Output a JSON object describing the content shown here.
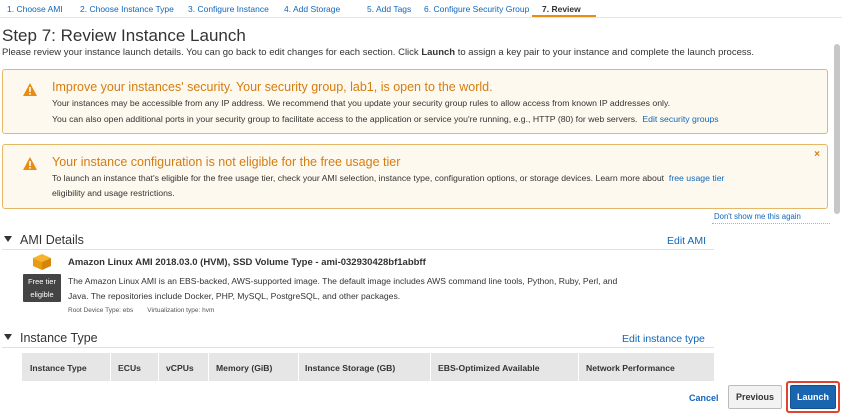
{
  "tabs": [
    {
      "label": "1. Choose AMI"
    },
    {
      "label": "2. Choose Instance Type"
    },
    {
      "label": "3. Configure Instance"
    },
    {
      "label": "4. Add Storage"
    },
    {
      "label": "5. Add Tags"
    },
    {
      "label": "6. Configure Security Group"
    },
    {
      "label": "7. Review",
      "active": true
    }
  ],
  "page": {
    "title": "Step 7: Review Instance Launch",
    "desc_before": "Please review your instance launch details. You can go back to edit changes for each section. Click ",
    "desc_bold": "Launch",
    "desc_after": " to assign a key pair to your instance and complete the launch process."
  },
  "security_warning": {
    "title": "Improve your instances' security. Your security group, lab1, is open to the world.",
    "line1": "Your instances may be accessible from any IP address. We recommend that you update your security group rules to allow access from known IP addresses only.",
    "line2": "You can also open additional ports in your security group to facilitate access to the application or service you're running, e.g., HTTP (80) for web servers.",
    "link": "Edit security groups"
  },
  "free_tier_warning": {
    "title": "Your instance configuration is not eligible for the free usage tier",
    "line1": "To launch an instance that's eligible for the free usage tier, check your AMI selection, instance type, configuration options, or storage devices. Learn more about",
    "link": "free usage tier",
    "line2": "eligibility and usage restrictions.",
    "close": "×"
  },
  "dont_show": "Don't show me this again",
  "ami_section": {
    "heading": "AMI Details",
    "edit_link": "Edit AMI",
    "badge_line1": "Free tier",
    "badge_line2": "eligible",
    "title": "Amazon Linux AMI 2018.03.0 (HVM), SSD Volume Type - ami-032930428bf1abbff",
    "desc": "The Amazon Linux AMI is an EBS-backed, AWS-supported image. The default image includes AWS command line tools, Python, Ruby, Perl, and Java. The repositories include Docker, PHP, MySQL, PostgreSQL, and other packages.",
    "root_device": "Root Device Type: ebs",
    "virtualization": "Virtualization type: hvm"
  },
  "instance_section": {
    "heading": "Instance Type",
    "edit_link": "Edit instance type",
    "columns": [
      "Instance Type",
      "ECUs",
      "vCPUs",
      "Memory (GiB)",
      "Instance Storage (GB)",
      "EBS-Optimized Available",
      "Network Performance"
    ]
  },
  "actions": {
    "cancel": "Cancel",
    "previous": "Previous",
    "launch": "Launch"
  },
  "colors": {
    "link": "#1166bb",
    "warning": "#d47d12",
    "launch_button": "#1a65b0",
    "highlight": "#e0432f"
  }
}
